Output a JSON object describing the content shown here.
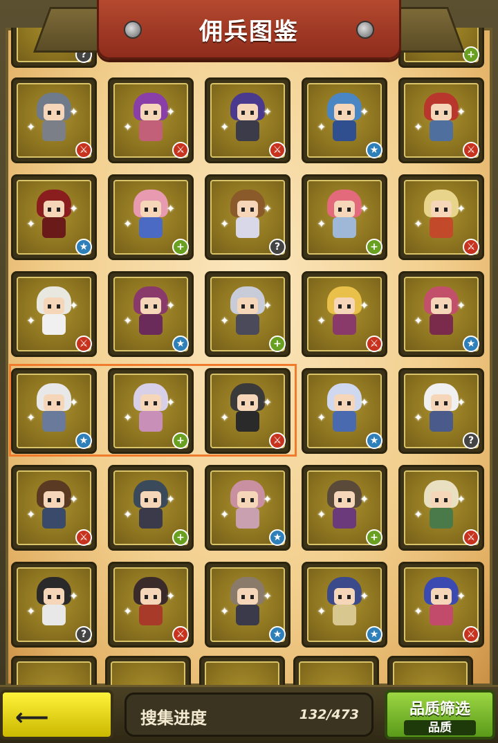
{
  "header": {
    "title": "佣兵图鉴"
  },
  "badges": {
    "red": "⚔",
    "blue": "★",
    "green": "+",
    "gray": "?"
  },
  "grid": {
    "rows": [
      [
        {
          "name": "hero-1-1",
          "hair": "#6f7a8a",
          "body": "#7b7f88",
          "badge": "red"
        },
        {
          "name": "hero-1-2",
          "hair": "#8a3fa8",
          "body": "#c2607a",
          "badge": "red"
        },
        {
          "name": "hero-1-3",
          "hair": "#4a3a8e",
          "body": "#3b3b4a",
          "badge": "red"
        },
        {
          "name": "hero-1-4",
          "hair": "#4a86c4",
          "body": "#2f4f8f",
          "badge": "blue"
        },
        {
          "name": "hero-1-5",
          "hair": "#b8362c",
          "body": "#4f6f9e",
          "badge": "red"
        }
      ],
      [
        {
          "name": "hero-2-1",
          "hair": "#8a1e1e",
          "body": "#6b1a1a",
          "badge": "blue"
        },
        {
          "name": "hero-2-2",
          "hair": "#e89ab0",
          "body": "#4a6ac4",
          "badge": "green"
        },
        {
          "name": "hero-2-3",
          "hair": "#8a5a2a",
          "body": "#d8d8e8",
          "badge": "gray"
        },
        {
          "name": "hero-2-4",
          "hair": "#e26a7a",
          "body": "#9fb8d8",
          "badge": "green"
        },
        {
          "name": "hero-2-5",
          "hair": "#e8d48a",
          "body": "#c24a2a",
          "badge": "red"
        }
      ],
      [
        {
          "name": "hero-3-1",
          "hair": "#e8e8e0",
          "body": "#f0f0f0",
          "badge": "red"
        },
        {
          "name": "hero-3-2",
          "hair": "#8a3a6a",
          "body": "#6a2a5a",
          "badge": "blue"
        },
        {
          "name": "hero-3-3",
          "hair": "#c8ccd8",
          "body": "#4a4a5a",
          "badge": "green"
        },
        {
          "name": "hero-3-4",
          "hair": "#e8c04a",
          "body": "#8a3a6a",
          "badge": "red"
        },
        {
          "name": "hero-3-5",
          "hair": "#c2506a",
          "body": "#7a2a4a",
          "badge": "blue"
        }
      ],
      [
        {
          "name": "hero-4-1",
          "hair": "#e8e8e8",
          "body": "#6a7a9a",
          "badge": "blue"
        },
        {
          "name": "hero-4-2",
          "hair": "#d8d0e8",
          "body": "#c890b8",
          "badge": "green"
        },
        {
          "name": "hero-4-3",
          "hair": "#3a3a3a",
          "body": "#2a2a2a",
          "badge": "red"
        },
        {
          "name": "hero-4-4",
          "hair": "#d0d8f0",
          "body": "#4a6ab0",
          "badge": "blue"
        },
        {
          "name": "hero-4-5",
          "hair": "#f0f0f0",
          "body": "#4a5a8a",
          "badge": "gray"
        }
      ],
      [
        {
          "name": "hero-5-1",
          "hair": "#5a3a22",
          "body": "#3a4a6a",
          "badge": "red"
        },
        {
          "name": "hero-5-2",
          "hair": "#3a4a5a",
          "body": "#3a3a4a",
          "badge": "green"
        },
        {
          "name": "hero-5-3",
          "hair": "#c890a0",
          "body": "#c8a0b0",
          "badge": "blue"
        },
        {
          "name": "hero-5-4",
          "hair": "#5a4a3a",
          "body": "#6a3a7a",
          "badge": "green"
        },
        {
          "name": "hero-5-5",
          "hair": "#e8e0c0",
          "body": "#4a7a4a",
          "badge": "red"
        }
      ],
      [
        {
          "name": "hero-6-1",
          "hair": "#2a2a2a",
          "body": "#e8e8e8",
          "badge": "gray"
        },
        {
          "name": "hero-6-2",
          "hair": "#3a2a2a",
          "body": "#a83a2a",
          "badge": "red"
        },
        {
          "name": "hero-6-3",
          "hair": "#8a7a6a",
          "body": "#3a3a4a",
          "badge": "blue"
        },
        {
          "name": "hero-6-4",
          "hair": "#3a4a8a",
          "body": "#d8c890",
          "badge": "blue"
        },
        {
          "name": "hero-6-5",
          "hair": "#3a4ab0",
          "body": "#c24a6a",
          "badge": "red"
        }
      ]
    ]
  },
  "footer": {
    "back_label": "⟵",
    "progress_label": "搜集进度",
    "progress_count": "132/473",
    "progress_value": 0.279,
    "filter_title": "品质筛选",
    "filter_sub": "品质"
  }
}
